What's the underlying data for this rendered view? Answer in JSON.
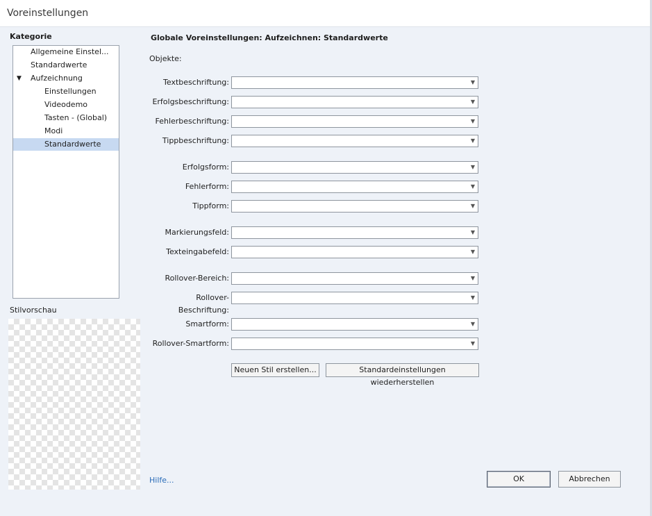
{
  "window": {
    "title": "Voreinstellungen"
  },
  "sidebar": {
    "heading": "Kategorie",
    "items": [
      {
        "label": "Allgemeine Einstel...",
        "level": 0
      },
      {
        "label": "Standardwerte",
        "level": 0
      },
      {
        "label": "Aufzeichnung",
        "level": 0,
        "expanded": true
      },
      {
        "label": "Einstellungen",
        "level": 1
      },
      {
        "label": "Videodemo",
        "level": 1
      },
      {
        "label": "Tasten - (Global)",
        "level": 1
      },
      {
        "label": "Modi",
        "level": 1
      },
      {
        "label": "Standardwerte",
        "level": 1,
        "selected": true
      }
    ],
    "preview_label": "Stilvorschau"
  },
  "main": {
    "heading": "Globale Voreinstellungen: Aufzeichnen: Standardwerte",
    "section_label": "Objekte:",
    "fields": [
      {
        "label": "Textbeschriftung:",
        "value": ""
      },
      {
        "label": "Erfolgsbeschriftung:",
        "value": ""
      },
      {
        "label": "Fehlerbeschriftung:",
        "value": ""
      },
      {
        "label": "Tippbeschriftung:",
        "value": ""
      },
      {
        "label": "Erfolgsform:",
        "value": ""
      },
      {
        "label": "Fehlerform:",
        "value": ""
      },
      {
        "label": "Tippform:",
        "value": ""
      },
      {
        "label": "Markierungsfeld:",
        "value": ""
      },
      {
        "label": "Texteingabefeld:",
        "value": ""
      },
      {
        "label": "Rollover-Bereich:",
        "value": ""
      },
      {
        "label": "Rollover-Beschriftung:",
        "value": ""
      },
      {
        "label": "Smartform:",
        "value": ""
      },
      {
        "label": "Rollover-Smartform:",
        "value": ""
      }
    ],
    "new_style_button": "Neuen Stil erstellen...",
    "restore_button": "Standardeinstellungen wiederherstellen"
  },
  "footer": {
    "help_link": "Hilfe...",
    "ok_button": "OK",
    "cancel_button": "Abbrechen"
  }
}
